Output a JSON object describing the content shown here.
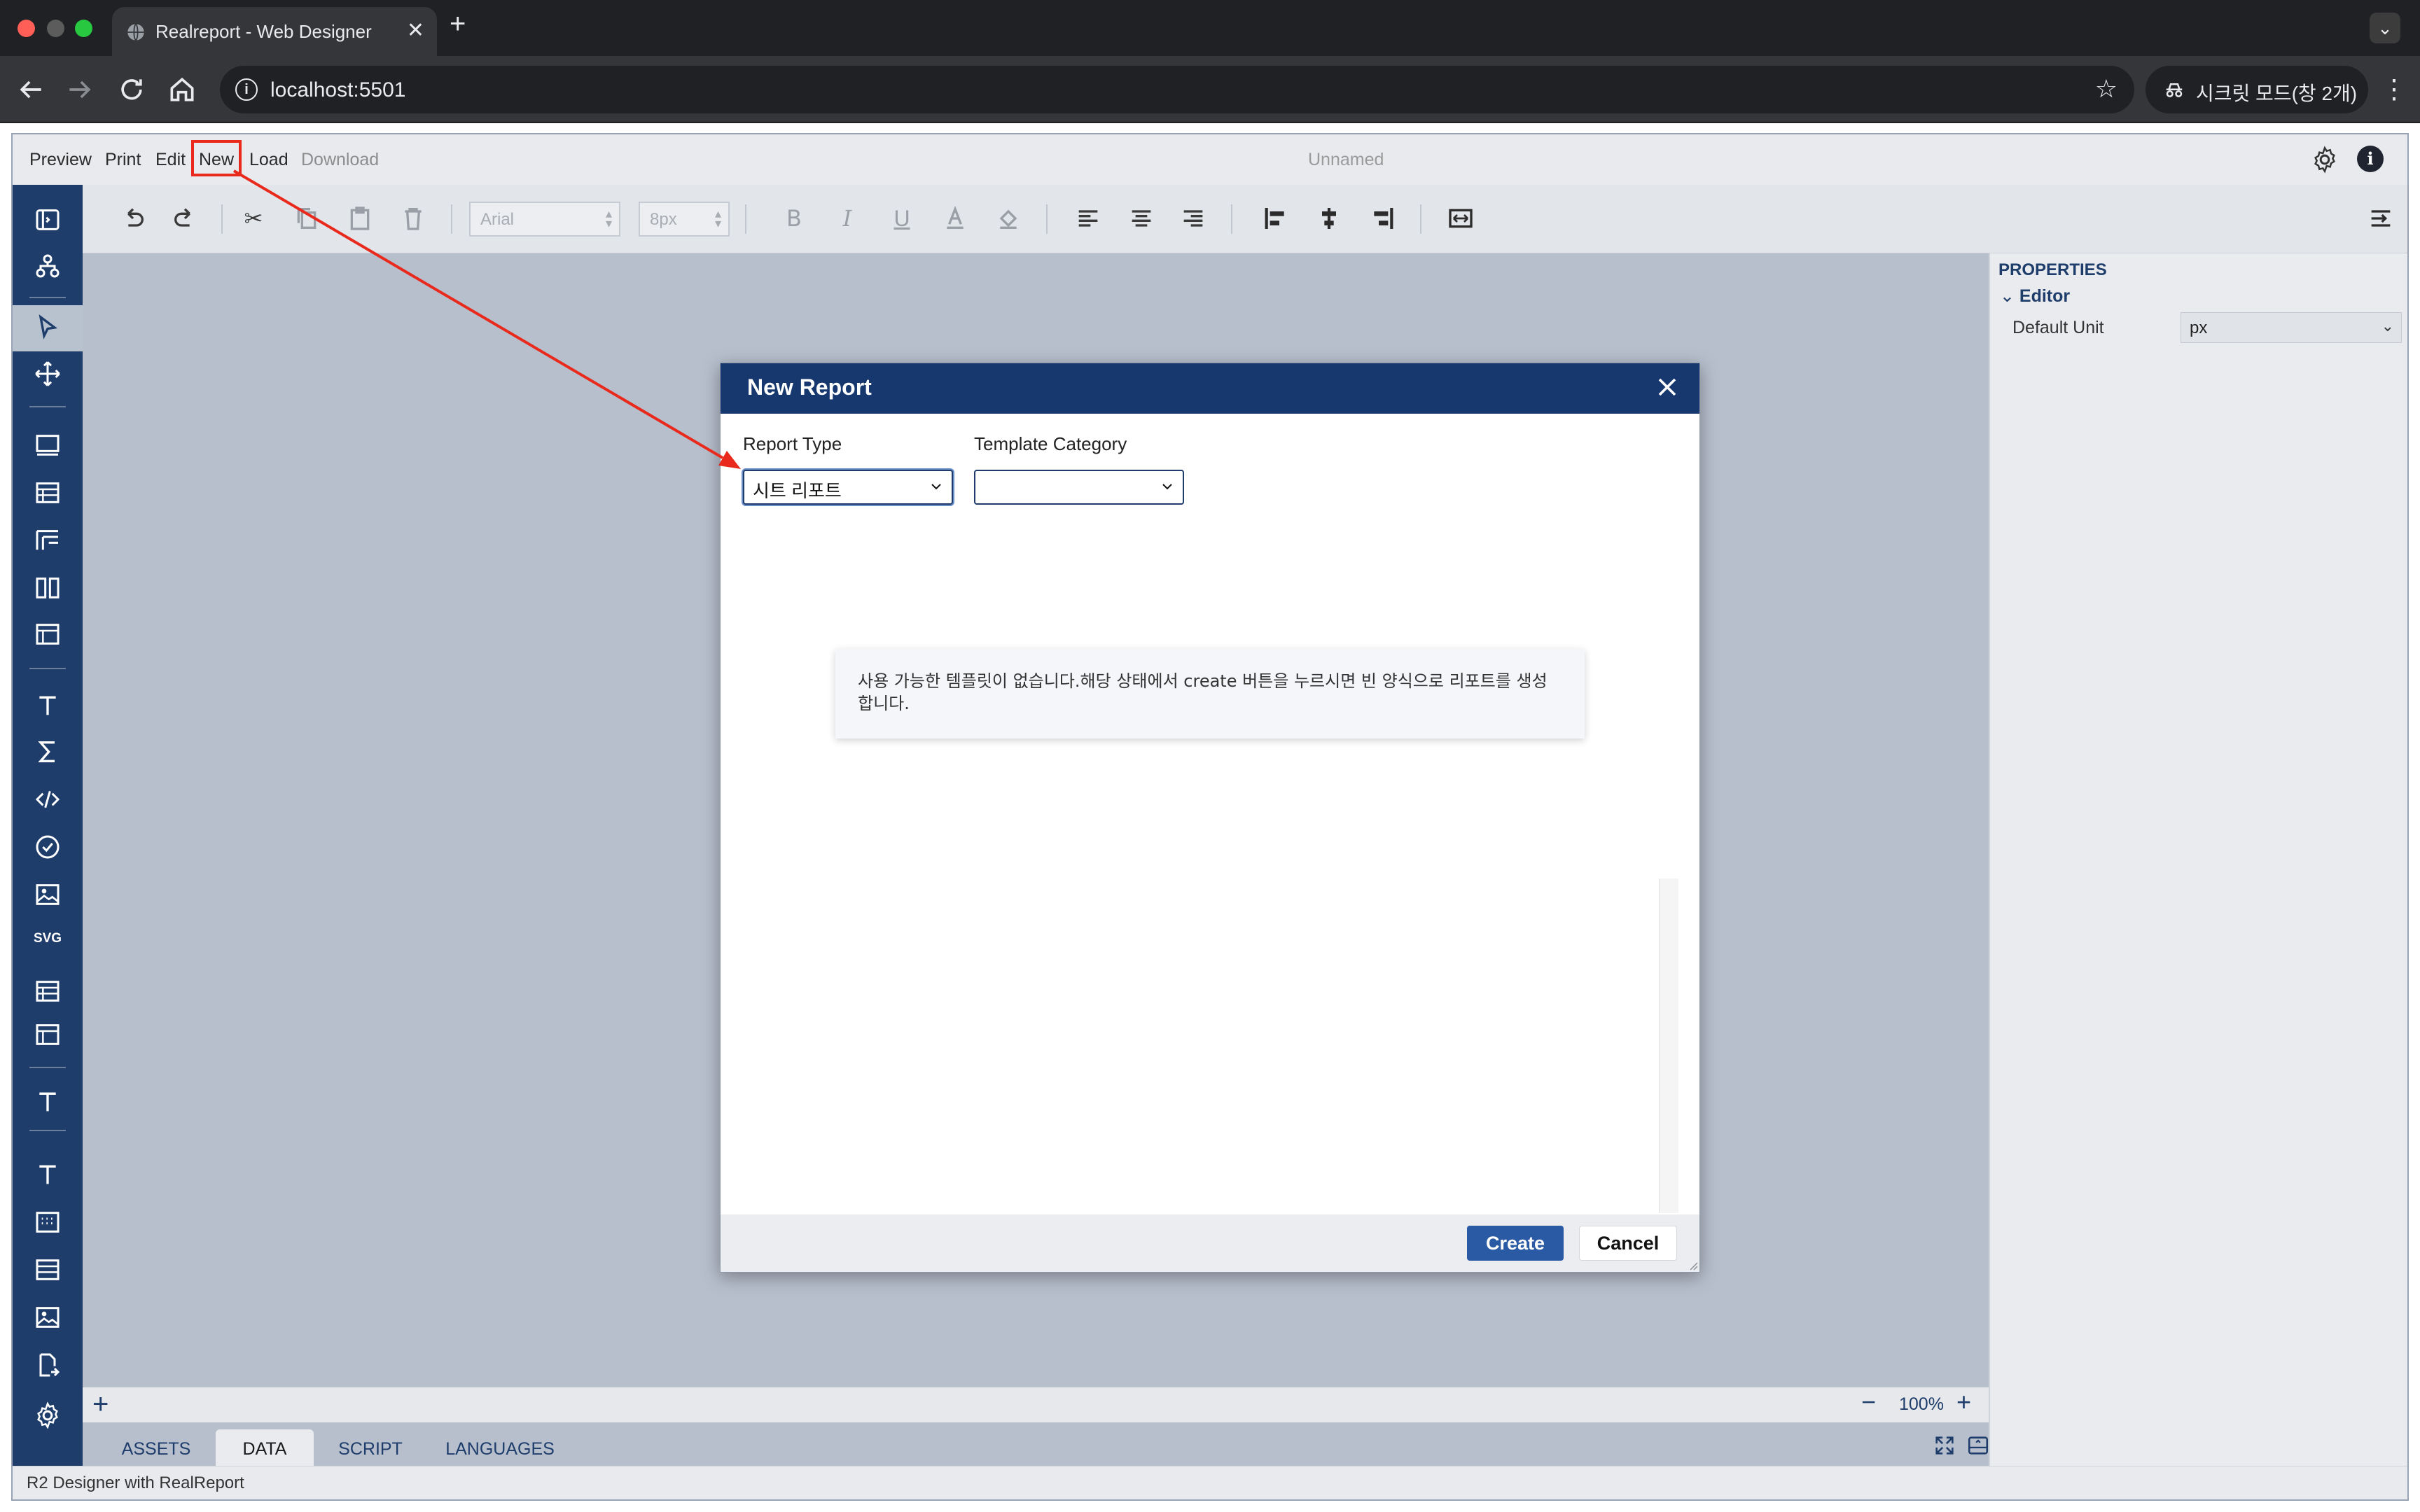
{
  "browser": {
    "tab_title": "Realreport - Web Designer",
    "url": "localhost:5501",
    "incognito_label": "시크릿 모드(창 2개)"
  },
  "app": {
    "menu": {
      "preview": "Preview",
      "print": "Print",
      "edit": "Edit",
      "new": "New",
      "load": "Load",
      "download": "Download"
    },
    "document_title": "Unnamed",
    "toolbar": {
      "font_family": "Arial",
      "font_size": "8px"
    },
    "left_toolbar": {
      "svg_label": "SVG"
    },
    "properties": {
      "title": "PROPERTIES",
      "group": "Editor",
      "default_unit_label": "Default Unit",
      "default_unit_value": "px"
    },
    "zoom": "100%",
    "bottom_tabs": [
      {
        "label": "ASSETS",
        "active": false
      },
      {
        "label": "DATA",
        "active": true
      },
      {
        "label": "SCRIPT",
        "active": false
      },
      {
        "label": "LANGUAGES",
        "active": false
      }
    ],
    "status_text": "R2 Designer with RealReport"
  },
  "modal": {
    "title": "New Report",
    "report_type_label": "Report Type",
    "report_type_value": "시트 리포트",
    "template_category_label": "Template Category",
    "template_category_value": "",
    "notice": "사용 가능한 템플릿이 없습니다.해당 상태에서 create 버튼을 누르시면 빈 양식으로 리포트를 생성합니다.",
    "create_label": "Create",
    "cancel_label": "Cancel"
  },
  "colors": {
    "annotation": "#e8291c",
    "brand_navy": "#16386e",
    "primary_button": "#2a5aa3"
  }
}
